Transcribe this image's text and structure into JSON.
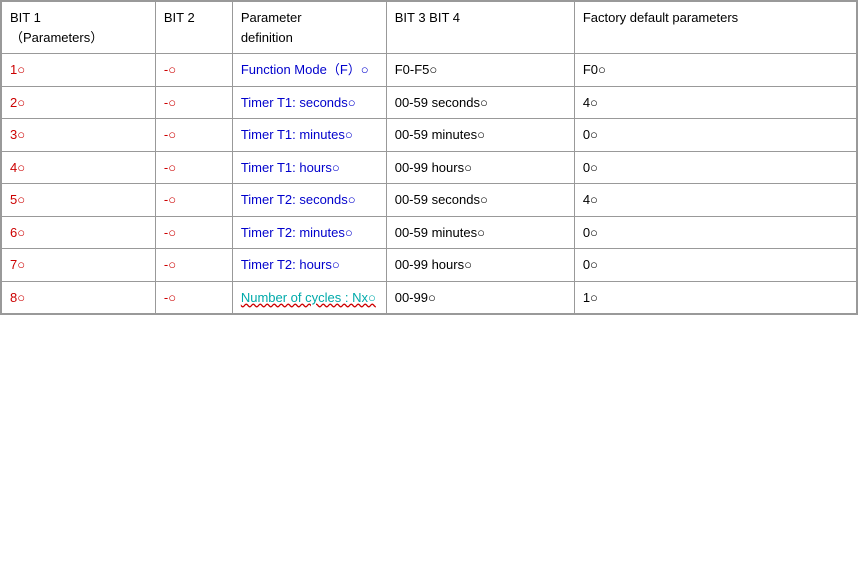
{
  "table": {
    "headers": {
      "bit1": "BIT 1\n（Parameters）",
      "bit2": "BIT 2",
      "param": "Parameter\ndefinition",
      "bit34": "BIT 3  BIT 4",
      "factory": "Factory default parameters"
    },
    "rows": [
      {
        "bit1": "1",
        "bit2": "-",
        "param": "Function Mode（F）",
        "bit34": "F0-F5",
        "factory": "F0",
        "param_color": "blue",
        "bit1_color": "red",
        "bit2_color": "red"
      },
      {
        "bit1": "2",
        "bit2": "-",
        "param": "Timer  T1: seconds",
        "bit34": "00-59 seconds",
        "factory": "4",
        "param_color": "blue",
        "bit1_color": "red",
        "bit2_color": "red"
      },
      {
        "bit1": "3",
        "bit2": "-",
        "param": "Timer  T1: minutes",
        "bit34": "00-59 minutes",
        "factory": "0",
        "param_color": "blue",
        "bit1_color": "red",
        "bit2_color": "red"
      },
      {
        "bit1": "4",
        "bit2": "-",
        "param": "Timer  T1: hours",
        "bit34": "00-99 hours",
        "factory": "0",
        "param_color": "blue",
        "bit1_color": "red",
        "bit2_color": "red"
      },
      {
        "bit1": "5",
        "bit2": "-",
        "param": "Timer  T2: seconds",
        "bit34": "00-59 seconds",
        "factory": "4",
        "param_color": "blue",
        "bit1_color": "red",
        "bit2_color": "red"
      },
      {
        "bit1": "6",
        "bit2": "-",
        "param": "Timer  T2: minutes",
        "bit34": "00-59 minutes",
        "factory": "0",
        "param_color": "blue",
        "bit1_color": "red",
        "bit2_color": "red"
      },
      {
        "bit1": "7",
        "bit2": "-",
        "param": "Timer  T2: hours",
        "bit34": "00-99 hours",
        "factory": "0",
        "param_color": "blue",
        "bit1_color": "red",
        "bit2_color": "red"
      },
      {
        "bit1": "8",
        "bit2": "-",
        "param": "Number of cycles : Nx",
        "bit34": "00-99",
        "factory": "1",
        "param_color": "cyan",
        "bit1_color": "red",
        "bit2_color": "red"
      }
    ]
  }
}
